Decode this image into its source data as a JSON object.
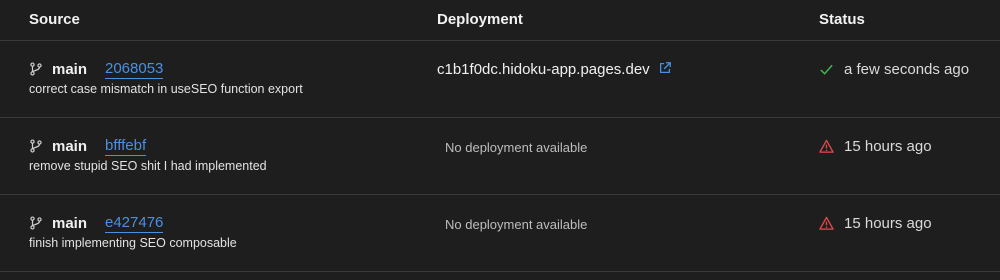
{
  "header": {
    "source": "Source",
    "deployment": "Deployment",
    "status": "Status"
  },
  "rows": [
    {
      "branch": "main",
      "commit": "2068053",
      "message": "correct case mismatch in useSEO function export",
      "deployment": "c1b1f0dc.hidoku-app.pages.dev",
      "status": "a few seconds ago",
      "status_icon": "check-icon",
      "status_color": "#3fb950"
    },
    {
      "branch": "main",
      "commit": "bfffebf",
      "message": "remove stupid SEO shit I had implemented",
      "deployment": "No deployment available",
      "status": "15 hours ago",
      "status_icon": "warning-icon",
      "status_color": "#e5484d"
    },
    {
      "branch": "main",
      "commit": "e427476",
      "message": "finish implementing SEO composable",
      "deployment": "No deployment available",
      "status": "15 hours ago",
      "status_icon": "warning-icon",
      "status_color": "#e5484d"
    }
  ],
  "colors": {
    "link": "#4a90e2",
    "background": "#1e1e1e",
    "divider": "#3a3a3a"
  }
}
